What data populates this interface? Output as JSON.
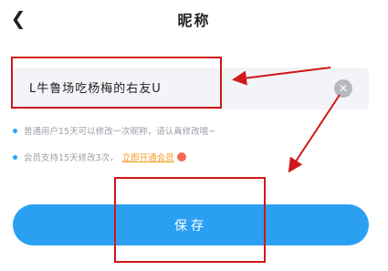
{
  "header": {
    "back_icon": "chevron-left-icon",
    "title": "昵称"
  },
  "input": {
    "value": "L牛鲁场吃杨梅的右友U",
    "clear_icon": "close-circle-icon"
  },
  "hints": {
    "normal": "普通用户15天可以修改一次昵称，请认真修改哦~",
    "member_prefix": "会员支持15天修改3次，",
    "member_link": "立即开通会员",
    "crown_icon": "crown-icon"
  },
  "save_button": {
    "label": "保存"
  },
  "annotations": {
    "color": "#d01818"
  },
  "colors": {
    "accent": "#2ba0f3",
    "link": "#f59b22"
  }
}
